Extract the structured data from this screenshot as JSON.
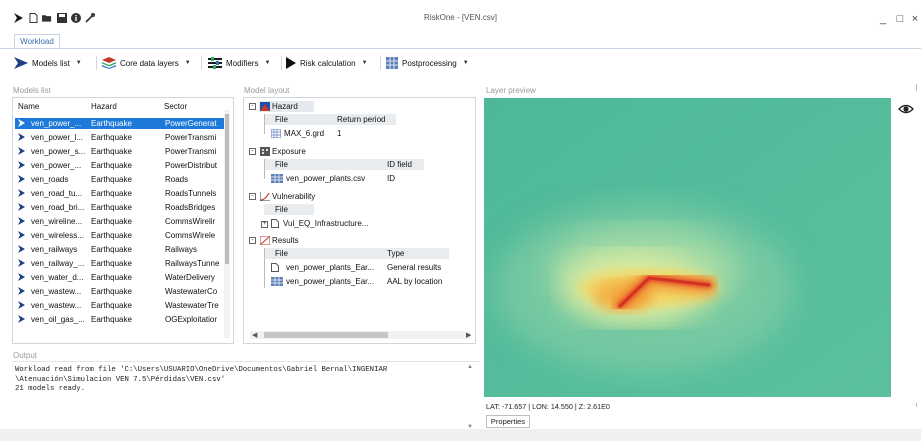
{
  "window": {
    "title": "RiskOne - [VEN.csv]",
    "minimize": "_",
    "maximize": "□",
    "close": "×"
  },
  "tabs": {
    "workload": "Workload"
  },
  "ribbon": {
    "models_list": "Models list",
    "core_data_layers": "Core data layers",
    "modifiers": "Modifiers",
    "risk_calculation": "Risk calculation",
    "postprocessing": "Postprocessing"
  },
  "models_list": {
    "label": "Models list",
    "columns": [
      "Name",
      "Hazard",
      "Sector"
    ],
    "rows": [
      [
        "ven_power_...",
        "Earthquake",
        "PowerGenerat"
      ],
      [
        "ven_power_l...",
        "Earthquake",
        "PowerTransmi"
      ],
      [
        "ven_power_s...",
        "Earthquake",
        "PowerTransmi"
      ],
      [
        "ven_power_...",
        "Earthquake",
        "PowerDistribut"
      ],
      [
        "ven_roads",
        "Earthquake",
        "Roads"
      ],
      [
        "ven_road_tu...",
        "Earthquake",
        "RoadsTunnels"
      ],
      [
        "ven_road_bri...",
        "Earthquake",
        "RoadsBridges"
      ],
      [
        "ven_wireline...",
        "Earthquake",
        "CommsWirelir"
      ],
      [
        "ven_wireless...",
        "Earthquake",
        "CommsWirele"
      ],
      [
        "ven_railways",
        "Earthquake",
        "Railways"
      ],
      [
        "ven_railway_...",
        "Earthquake",
        "RailwaysTunne"
      ],
      [
        "ven_water_d...",
        "Earthquake",
        "WaterDelivery"
      ],
      [
        "ven_wastew...",
        "Earthquake",
        "WastewaterCo"
      ],
      [
        "ven_wastew...",
        "Earthquake",
        "WastewaterTre"
      ],
      [
        "ven_oil_gas_...",
        "Earthquake",
        "OGExploitatior"
      ]
    ]
  },
  "model_layout": {
    "label": "Model layout",
    "hazard": {
      "title": "Hazard",
      "col_file": "File",
      "col_extra": "Return period",
      "file": "MAX_6.grd",
      "value": "1"
    },
    "exposure": {
      "title": "Exposure",
      "col_file": "File",
      "col_extra": "ID field",
      "file": "ven_power_plants.csv",
      "value": "ID"
    },
    "vulnerability": {
      "title": "Vulnerability",
      "col_file": "File",
      "file": "Vul_EQ_Infrastructure..."
    },
    "results": {
      "title": "Results",
      "col_file": "File",
      "col_extra": "Type",
      "items": [
        {
          "file": "ven_power_plants_Ear...",
          "type": "General results"
        },
        {
          "file": "ven_power_plants_Ear...",
          "type": "AAL by location"
        }
      ]
    }
  },
  "layer_preview": {
    "label": "Layer preview",
    "coords": "LAT: -71.657 | LON: 14.550 | Z: 2.61E0",
    "properties_tab": "Properties"
  },
  "output": {
    "label": "Output",
    "lines": [
      "Workload read from file 'C:\\Users\\USUARIO\\OneDrive\\Documentos\\Gabriel Bernal\\INGENIAR",
      "\\Atenuación\\Simulacion VEN 7.5\\Pérdidas\\VEN.csv'",
      "21 models ready."
    ]
  },
  "colors": {
    "selection": "#1e7ad8",
    "accent": "#3a6fb0",
    "arrow": "#1d3f82"
  },
  "icons": [
    "app-arrow-icon",
    "new-file-icon",
    "open-folder-icon",
    "save-icon",
    "info-icon",
    "wrench-icon",
    "eye-icon"
  ]
}
